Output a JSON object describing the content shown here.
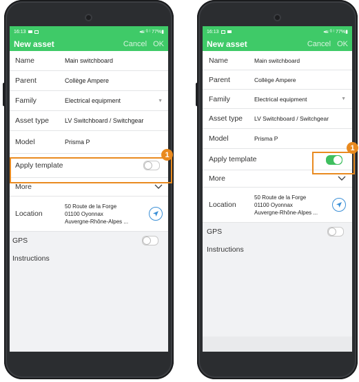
{
  "status_bar": {
    "time": "16:13",
    "right_icons": "◂ผ ᴳ ˡ 77%▮"
  },
  "app_bar": {
    "title": "New asset",
    "cancel_label": "Cancel",
    "ok_label": "OK"
  },
  "fields": {
    "name": {
      "label": "Name",
      "value": "Main switchboard"
    },
    "parent": {
      "label": "Parent",
      "value": "Collège Ampere"
    },
    "family": {
      "label": "Family",
      "value": "Electrical equipment"
    },
    "asset_type": {
      "label": "Asset type",
      "value": "LV Switchboard / Switchgear"
    },
    "model": {
      "label": "Model",
      "value": "Prisma P"
    },
    "apply_template": {
      "label": "Apply template"
    },
    "more": {
      "label": "More"
    },
    "location": {
      "label": "Location",
      "line1": "50 Route de la Forge",
      "line2": "01100 Oyonnax",
      "line3": "Auvergne-Rhône-Alpes ..."
    },
    "gps": {
      "label": "GPS"
    },
    "instructions": {
      "label": "Instructions"
    }
  },
  "left_phone": {
    "apply_template_on": false,
    "gps_on": false
  },
  "right_phone": {
    "apply_template_on": true,
    "gps_on": false
  },
  "callout": {
    "number": "1"
  },
  "colors": {
    "accent_green": "#3fca68",
    "toggle_on": "#3fbf5f",
    "highlight_orange": "#e98a1f",
    "location_blue": "#3a8fd6"
  }
}
